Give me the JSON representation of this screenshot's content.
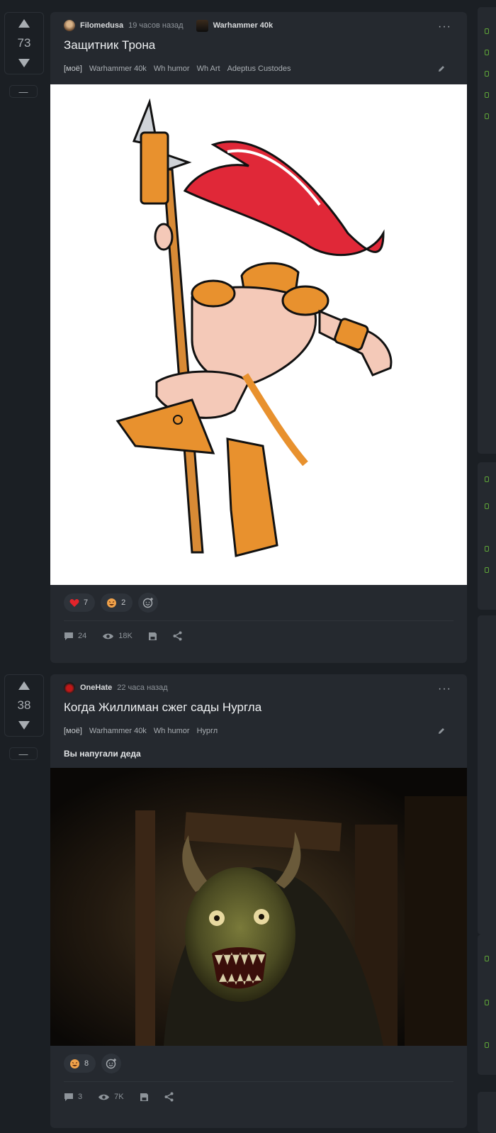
{
  "posts": [
    {
      "score": "73",
      "minus_label": "—",
      "author": "Filomedusa",
      "time": "19 часов назад",
      "community": "Warhammer 40k",
      "more": "···",
      "title": "Защитник Трона",
      "tags": [
        "[моё]",
        "Warhammer 40k",
        "Wh humor",
        "Wh Art",
        "Adeptus Custodes"
      ],
      "reactions": [
        {
          "icon": "heart-icon",
          "count": "7"
        },
        {
          "icon": "laugh-icon",
          "count": "2"
        }
      ],
      "comments": "24",
      "views": "18K"
    },
    {
      "score": "38",
      "minus_label": "—",
      "author": "OneHate",
      "time": "22 часа назад",
      "more": "···",
      "title": "Когда Жиллиман сжег сады Нургла",
      "tags": [
        "[моё]",
        "Warhammer 40k",
        "Wh humor",
        "Нургл"
      ],
      "description": "Вы напугали деда",
      "reactions": [
        {
          "icon": "laugh-icon",
          "count": "8"
        }
      ],
      "comments": "3",
      "views": "7K"
    }
  ],
  "colors": {
    "background": "#1b1f24",
    "card": "#25292f",
    "heart": "#e3242b",
    "accent_green": "#5fa538"
  }
}
